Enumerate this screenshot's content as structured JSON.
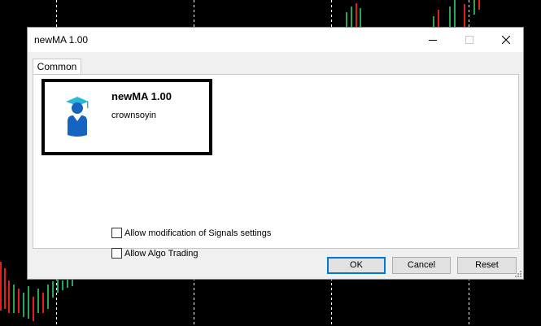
{
  "window": {
    "title": "newMA 1.00"
  },
  "window_controls": {
    "minimize": "minimize-icon",
    "maximize": "maximize-icon",
    "close": "close-icon"
  },
  "tabs": [
    {
      "label": "Common",
      "selected": true
    }
  ],
  "program": {
    "name": "newMA 1.00",
    "author": "crownsoyin",
    "icon": "graduate-avatar-icon"
  },
  "options": [
    {
      "label": "Allow modification of Signals settings",
      "checked": false
    },
    {
      "label": "Allow Algo Trading",
      "checked": false
    }
  ],
  "buttons": {
    "ok": "OK",
    "cancel": "Cancel",
    "reset": "Reset"
  },
  "colors": {
    "accent": "#0078d7",
    "bull": "#26a65b",
    "bear": "#e02020",
    "avatar": "#1565c0",
    "cap": "#29b6d9"
  }
}
